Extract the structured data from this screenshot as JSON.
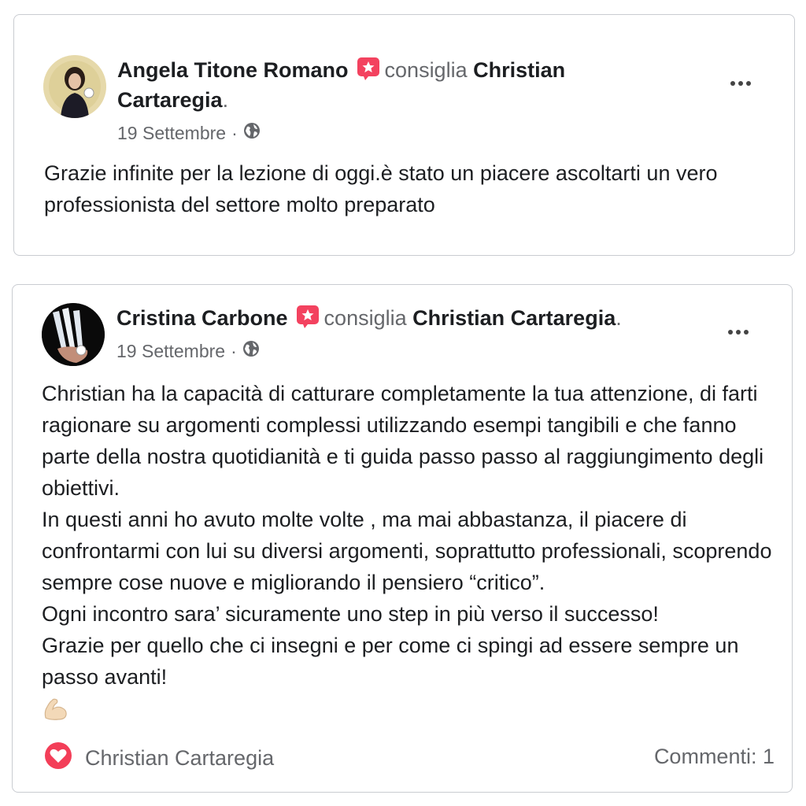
{
  "reviews": [
    {
      "author": "Angela Titone Romano",
      "verb": "consiglia",
      "page": "Christian Cartaregia",
      "period": ".",
      "date": "19 Settembre",
      "separator": "·",
      "text": "Grazie infinite per la lezione di oggi.è stato un piacere ascoltarti un vero professionista del settore molto preparato"
    },
    {
      "author": "Cristina Carbone",
      "verb": "consiglia",
      "page": "Christian Cartaregia",
      "period": ".",
      "date": "19 Settembre",
      "separator": "·",
      "text": "Christian ha la capacità di catturare completamente la tua attenzione, di farti ragionare su argomenti complessi utilizzando esempi tangibili e che fanno parte della nostra quotidianità e ti guida passo passo al raggiungimento degli obiettivi.\nIn questi anni ho avuto molte volte , ma mai abbastanza, il piacere di confrontarmi con lui su diversi argomenti, soprattutto professionali, scoprendo sempre cose nuove e migliorando il pensiero “critico”.\nOgni incontro sara’ sicuramente uno step in più verso il successo!\nGrazie per quello che ci insegni e per come ci spingi ad essere sempre un passo avanti!",
      "emoji": "flexed-biceps",
      "reaction_name": "Christian Cartaregia",
      "comments": "Commenti: 1"
    }
  ],
  "colors": {
    "recommend_badge": "#f3425f",
    "muted_text": "#65676b",
    "border": "#c9ccd1",
    "love_reaction": "#f33e58"
  }
}
